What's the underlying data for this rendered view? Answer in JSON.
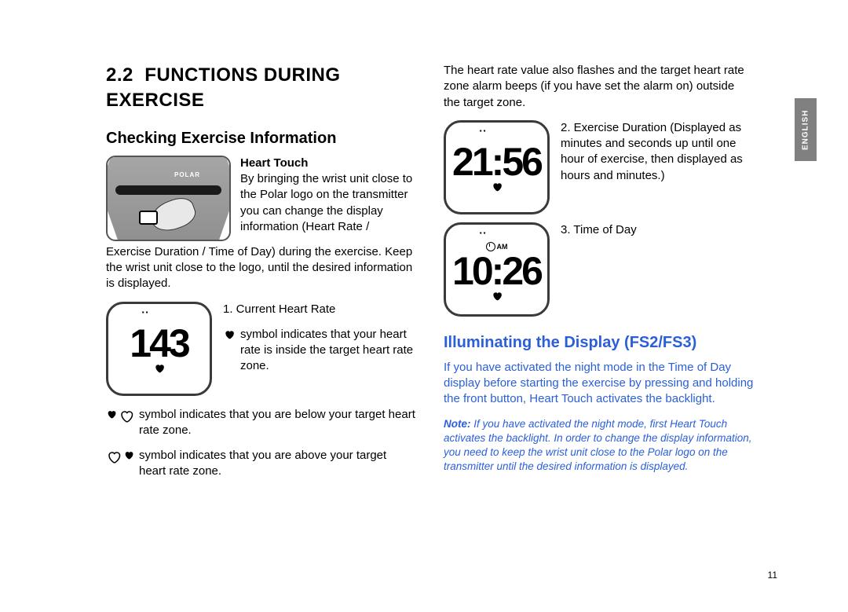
{
  "side_tab": "ENGLISH",
  "page_number": "11",
  "col1": {
    "section_number": "2.2",
    "section_title": "FUNCTIONS DURING EXERCISE",
    "sub1": "Checking Exercise Information",
    "heart_touch_hdr": "Heart Touch",
    "polar_logo": "POLAR",
    "heart_touch_right": "By bringing the wrist unit close to the Polar logo on the transmitter you can change the display information (Heart Rate /",
    "heart_touch_cont": "Exercise Duration / Time of Day) during the exercise. Keep the wrist unit close to the logo, until the desired information is displayed.",
    "watch1_value": "143",
    "item1_label": "1.  Current Heart Rate",
    "inside_zone": " symbol indicates that your heart rate is inside the target heart rate zone.",
    "below_zone": " symbol indicates that you are below your target heart rate zone.",
    "above_zone": " symbol indicates that you are above your target heart rate zone."
  },
  "col2": {
    "top_para": "The heart rate value also flashes and the target heart rate zone alarm beeps (if you have set the alarm on) outside the target zone.",
    "watch2_value": "21:56",
    "item2_label": "2.  Exercise Duration (Displayed as minutes and seconds up until one hour of exercise, then displayed as hours and minutes.)",
    "watch3_mode": "AM",
    "watch3_value": "10:26",
    "item3_label": "3.  Time of Day",
    "illum_hdr": "Illuminating the Display (FS2/FS3)",
    "illum_body": "If you have activated the night mode in the Time of Day display before starting the exercise by pressing and holding the front button, Heart Touch activates the backlight.",
    "note_bold": "Note:",
    "note_body": " If you have activated the night mode, first Heart Touch activates the backlight. In order to change the display information, you need to keep the wrist unit close to the Polar logo on the transmitter until the desired information is displayed."
  }
}
